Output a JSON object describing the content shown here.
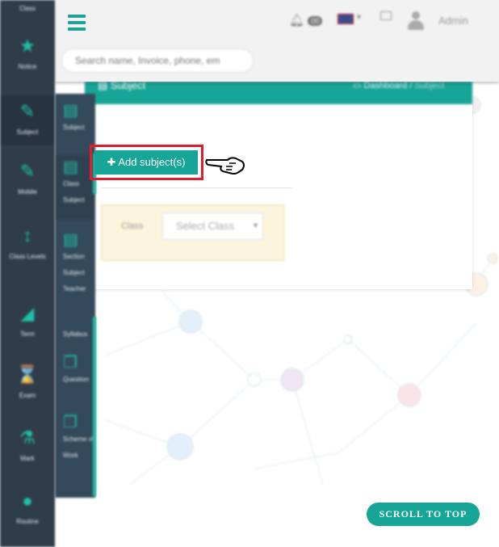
{
  "sidebar": {
    "top_label": "Class",
    "items": [
      {
        "icon": "star-icon",
        "label": "Notice"
      },
      {
        "icon": "edit-icon",
        "label": "Subject"
      },
      {
        "icon": "edit-icon",
        "label": "Mobile"
      },
      {
        "icon": "arrows-vertical-icon",
        "label": "Class Levels"
      },
      {
        "icon": "chart-icon",
        "label": "Term"
      },
      {
        "icon": "hourglass-icon",
        "label": "Exam"
      },
      {
        "icon": "flask-icon",
        "label": "Mark"
      },
      {
        "icon": "circle-icon",
        "label": "Routine"
      }
    ]
  },
  "subbar": {
    "items": [
      {
        "icon": "box-icon",
        "label": "Subject"
      },
      {
        "icon": "box-icon",
        "label": "Class Subject"
      },
      {
        "icon": "box-icon",
        "label": "Section Subject Teacher"
      },
      {
        "icon": "syllabus-icon",
        "label": "Syllabus"
      },
      {
        "icon": "files-icon",
        "label": "Question"
      },
      {
        "icon": "files-icon",
        "label": "Scheme of Work"
      }
    ]
  },
  "header": {
    "notification_count": "00",
    "user_name": "Admin",
    "search_placeholder": "Search name, Invoice, phone, em"
  },
  "page": {
    "title": "Subject",
    "breadcrumb_home": "Dashboard",
    "breadcrumb_sep": "/",
    "breadcrumb_current": "Subject",
    "add_button": "Add subject(s)",
    "class_label": "Class",
    "class_select": "Select Class",
    "scroll_top": "SCROLL TO TOP"
  },
  "colors": {
    "accent": "#17a598",
    "sidebar": "#2f3d4a",
    "highlight_frame": "#e41c2a"
  }
}
